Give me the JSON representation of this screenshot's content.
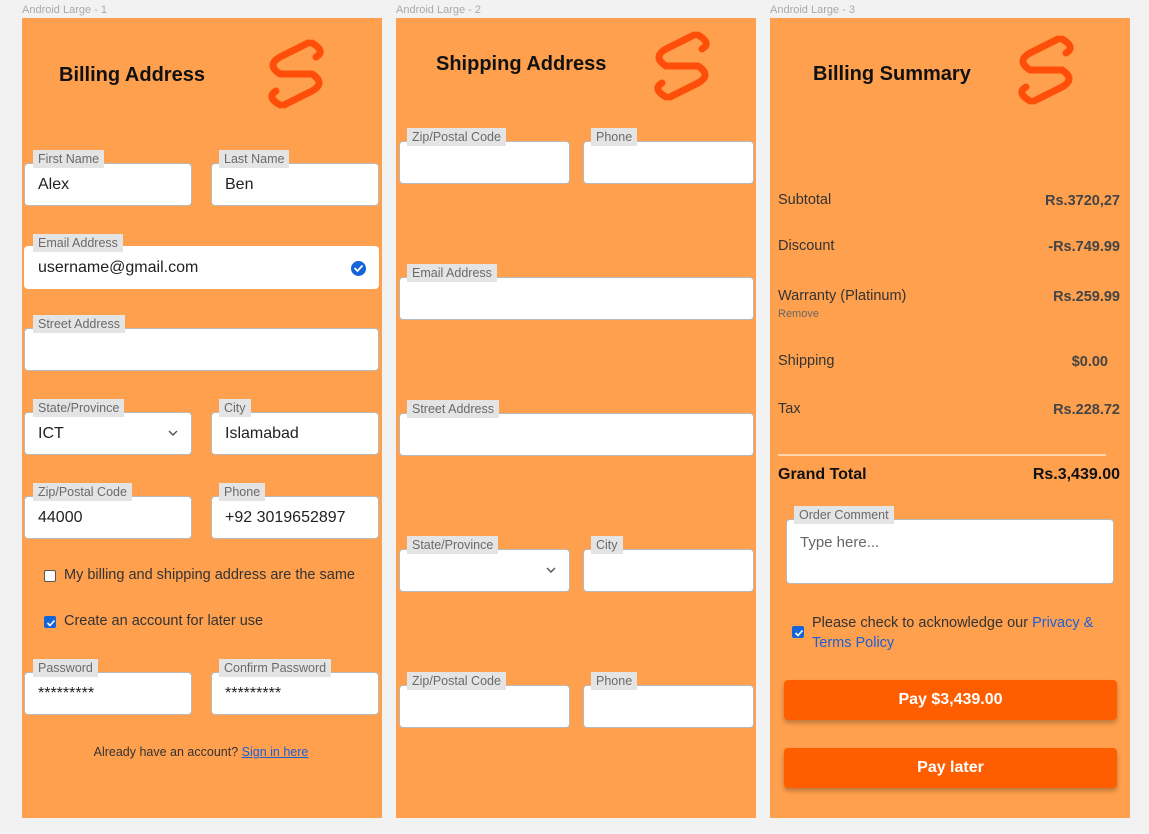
{
  "frames": {
    "f1": "Android Large - 1",
    "f2": "Android Large - 2",
    "f3": "Android Large - 3"
  },
  "billing": {
    "title": "Billing Address",
    "first_name_label": "First Name",
    "first_name_value": "Alex",
    "last_name_label": "Last Name",
    "last_name_value": "Ben",
    "email_label": "Email Address",
    "email_value": "username@gmail.com",
    "street_label": "Street Address",
    "street_value": "",
    "state_label": "State/Province",
    "state_value": "ICT",
    "city_label": "City",
    "city_value": "Islamabad",
    "zip_label": "Zip/Postal Code",
    "zip_value": "44000",
    "phone_label": "Phone",
    "phone_value": "+92 3019652897",
    "same_address_text": "My billing and shipping address are the same",
    "same_address_checked": false,
    "create_account_text": "Create an account for later use",
    "create_account_checked": true,
    "password_label": "Password",
    "password_value": "*********",
    "confirm_password_label": "Confirm Password",
    "confirm_password_value": "*********",
    "signin_prompt": "Already have an account?",
    "signin_link": "Sign in here"
  },
  "shipping": {
    "title": "Shipping Address",
    "zip_label": "Zip/Postal Code",
    "phone_label": "Phone",
    "email_label": "Email Address",
    "street_label": "Street Address",
    "state_label": "State/Province",
    "city_label": "City",
    "zip2_label": "Zip/Postal Code",
    "phone2_label": "Phone"
  },
  "summary": {
    "title": "Billing Summary",
    "rows": [
      {
        "label": "Subtotal",
        "value": "Rs.3720,27"
      },
      {
        "label": "Discount",
        "value": "-Rs.749.99"
      },
      {
        "label": "Warranty (Platinum)",
        "value": "Rs.259.99",
        "sub": "Remove"
      },
      {
        "label": "Shipping",
        "value": "$0.00"
      },
      {
        "label": "Tax",
        "value": "Rs.228.72"
      }
    ],
    "grand_total_label": "Grand Total",
    "grand_total_value": "Rs.3,439.00",
    "comment_label": "Order Comment",
    "comment_placeholder": "Type here...",
    "ack_text": "Please check to acknowledge our",
    "ack_link_1": "Privacy &",
    "ack_link_2": "Terms Policy",
    "ack_checked": true,
    "pay_button": "Pay $3,439.00",
    "pay_later_button": "Pay later"
  },
  "colors": {
    "panel": "#ffa04e",
    "accent": "#ff5e00",
    "logo": "#ff4e0a",
    "link": "#1e5fd6",
    "checkbox": "#1565d8"
  },
  "icons": [
    "brand-logo-icon",
    "verified-check-icon",
    "chevron-down-icon",
    "checkbox-check-icon"
  ]
}
